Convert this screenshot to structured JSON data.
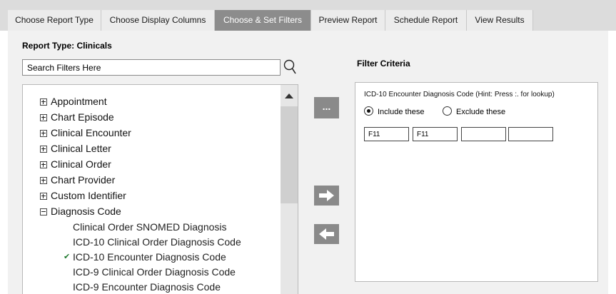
{
  "tabs": [
    {
      "label": "Choose Report Type",
      "active": false
    },
    {
      "label": "Choose Display Columns",
      "active": false
    },
    {
      "label": "Choose & Set Filters",
      "active": true
    },
    {
      "label": "Preview Report",
      "active": false
    },
    {
      "label": "Schedule Report",
      "active": false
    },
    {
      "label": "View Results",
      "active": false
    }
  ],
  "report_type_label": "Report Type: Clinicals",
  "search": {
    "placeholder": "Search Filters Here",
    "value": ""
  },
  "tree": {
    "categories": [
      {
        "label": "Appointment",
        "expanded": false
      },
      {
        "label": "Chart Episode",
        "expanded": false
      },
      {
        "label": "Clinical Encounter",
        "expanded": false
      },
      {
        "label": "Clinical Letter",
        "expanded": false
      },
      {
        "label": "Clinical Order",
        "expanded": false
      },
      {
        "label": "Chart Provider",
        "expanded": false
      },
      {
        "label": "Custom Identifier",
        "expanded": false
      },
      {
        "label": "Diagnosis Code",
        "expanded": true
      }
    ],
    "diagnosis_children": [
      {
        "label": "Clinical Order SNOMED Diagnosis",
        "selected": false
      },
      {
        "label": "ICD-10 Clinical Order Diagnosis Code",
        "selected": false
      },
      {
        "label": "ICD-10 Encounter Diagnosis Code",
        "selected": true
      },
      {
        "label": "ICD-9 Clinical Order Diagnosis Code",
        "selected": false
      },
      {
        "label": "ICD-9 Encounter Diagnosis Code",
        "selected": false
      }
    ]
  },
  "buttons": {
    "more_label": "..."
  },
  "filter_criteria": {
    "title": "Filter Criteria",
    "field_label": "ICD-10 Encounter Diagnosis Code (Hint: Press :. for lookup)",
    "include_label": "Include these",
    "exclude_label": "Exclude these",
    "selected_option": "include",
    "codes": [
      "F11",
      "F11",
      "",
      ""
    ]
  },
  "colors": {
    "tab_active_bg": "#8c8c8c",
    "tab_bg": "#ececec",
    "panel_bg": "#f1f1f1",
    "button_gray": "#8a8a8a",
    "check_green": "#1f7a2e"
  },
  "icons": {
    "search": "search-icon",
    "expand": "plus-box-icon",
    "collapse": "minus-box-icon",
    "check": "checkmark-icon",
    "add": "arrow-right-icon",
    "remove": "arrow-left-icon",
    "scroll_up": "scroll-up-icon"
  }
}
